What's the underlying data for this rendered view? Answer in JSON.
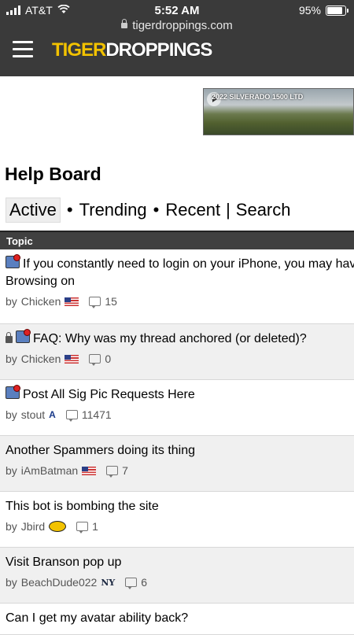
{
  "status": {
    "carrier": "AT&T",
    "time": "5:52 AM",
    "battery": "95%"
  },
  "browser": {
    "url": "tigerdroppings.com"
  },
  "site": {
    "logo_part1": "TIGER",
    "logo_part2": "DROPPINGS"
  },
  "ad": {
    "label": "2022 SILVERADO 1500 LTD"
  },
  "page": {
    "title": "Help Board"
  },
  "nav": {
    "active": "Active",
    "trending": "Trending",
    "recent": "Recent",
    "search": "Search",
    "dot": "•",
    "bar": "|"
  },
  "table": {
    "header": "Topic"
  },
  "topics": [
    {
      "title": "If you constantly need to login on your iPhone, you may have Private Browsing on",
      "author": "Chicken",
      "replies": "15"
    },
    {
      "title": "FAQ: Why was my thread anchored (or deleted)?",
      "author": "Chicken",
      "replies": "0"
    },
    {
      "title": "Post All Sig Pic Requests Here",
      "author": "stout",
      "replies": "11471"
    },
    {
      "title": "Another Spammers doing its thing",
      "author": "iAmBatman",
      "replies": "7"
    },
    {
      "title": "This bot is bombing the site",
      "author": "Jbird",
      "replies": "1"
    },
    {
      "title": "Visit Branson pop up",
      "author": "BeachDude022",
      "replies": "6"
    },
    {
      "title": "Can I get my avatar ability back?"
    }
  ],
  "meta": {
    "by": "by"
  },
  "team_marks": {
    "stout": "A",
    "beachdude": "NY"
  }
}
